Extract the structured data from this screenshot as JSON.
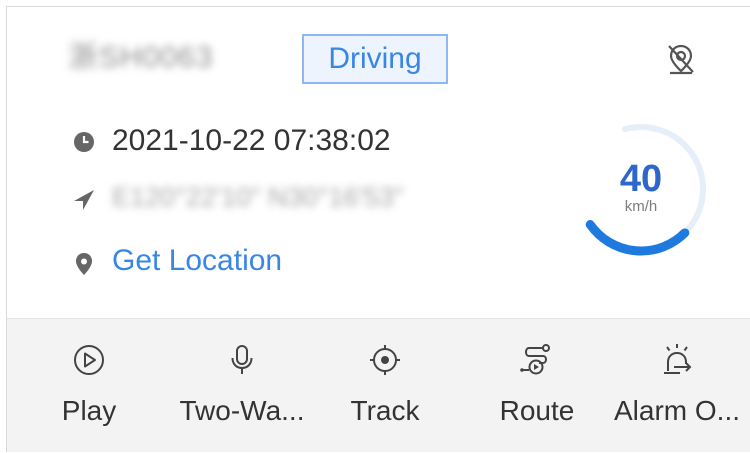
{
  "vehicle": {
    "plate": "浙SH0063",
    "status": "Driving",
    "time": "2021-10-22 07:38:02",
    "coordinates": "E120°22'10\" N30°16'53\"",
    "get_location_label": "Get Location"
  },
  "speed": {
    "value": "40",
    "unit": "km/h",
    "fraction": 0.4
  },
  "toolbar": [
    {
      "label": "Play",
      "icon": "play-icon"
    },
    {
      "label": "Two-Wa...",
      "icon": "microphone-icon"
    },
    {
      "label": "Track",
      "icon": "crosshair-icon"
    },
    {
      "label": "Route",
      "icon": "route-icon"
    },
    {
      "label": "Alarm O...",
      "icon": "alarm-output-icon"
    }
  ],
  "colors": {
    "accent": "#3a86e6",
    "gauge_track": "#e6eefa",
    "gauge_fill": "#1f7ae0",
    "toolbar_bg": "#f3f3f3"
  }
}
